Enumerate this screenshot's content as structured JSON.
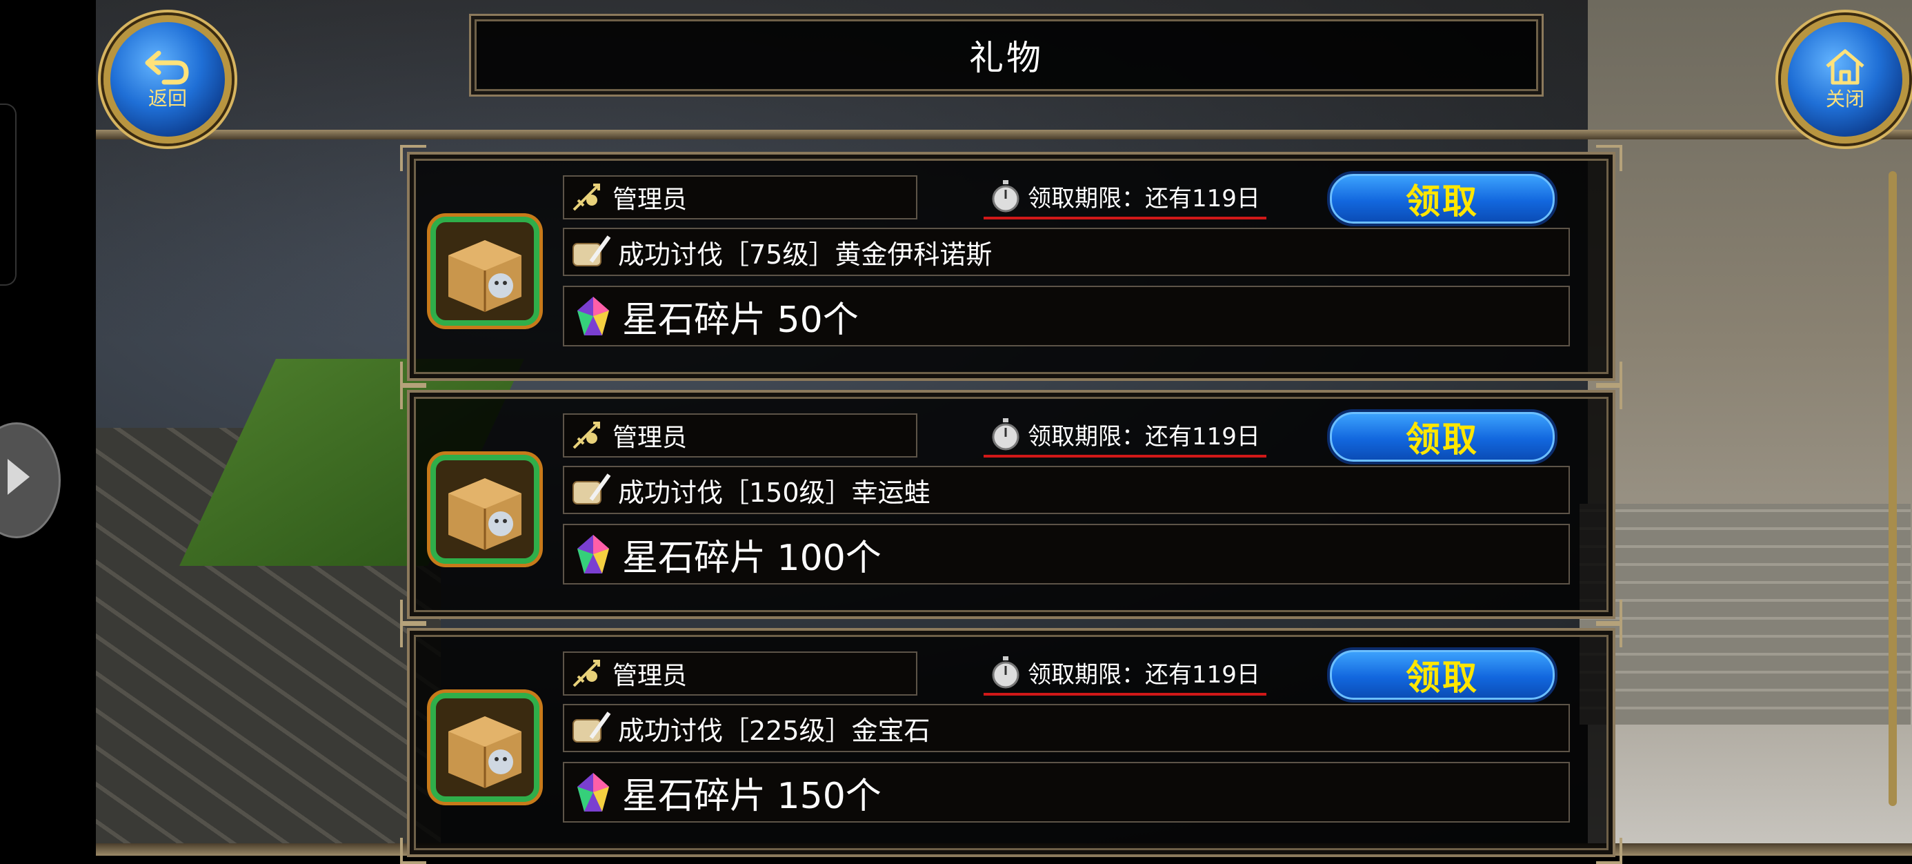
{
  "header": {
    "title": "礼物"
  },
  "nav": {
    "back_label": "返回",
    "close_label": "关闭"
  },
  "gifts": [
    {
      "sender": "管理员",
      "deadline": "领取期限：还有119日",
      "claim_label": "领取",
      "description": "成功讨伐［75级］黄金伊科诺斯",
      "reward": "星石碎片  50个"
    },
    {
      "sender": "管理员",
      "deadline": "领取期限：还有119日",
      "claim_label": "领取",
      "description": "成功讨伐［150级］幸运蛙",
      "reward": "星石碎片  100个"
    },
    {
      "sender": "管理员",
      "deadline": "领取期限：还有119日",
      "claim_label": "领取",
      "description": "成功讨伐［225级］金宝石",
      "reward": "星石碎片  150个"
    }
  ],
  "icons": {
    "back": "back-arrow-icon",
    "close": "home-icon",
    "gift": "gift-box-icon",
    "sender": "admin-sword-icon",
    "timer": "stopwatch-icon",
    "description": "scroll-quill-icon",
    "reward": "star-stone-icon"
  },
  "colors": {
    "claim_text": "#ffe600",
    "claim_button": "#1267de",
    "deadline_underline": "#d01818",
    "gift_border": "#2fae4a"
  }
}
